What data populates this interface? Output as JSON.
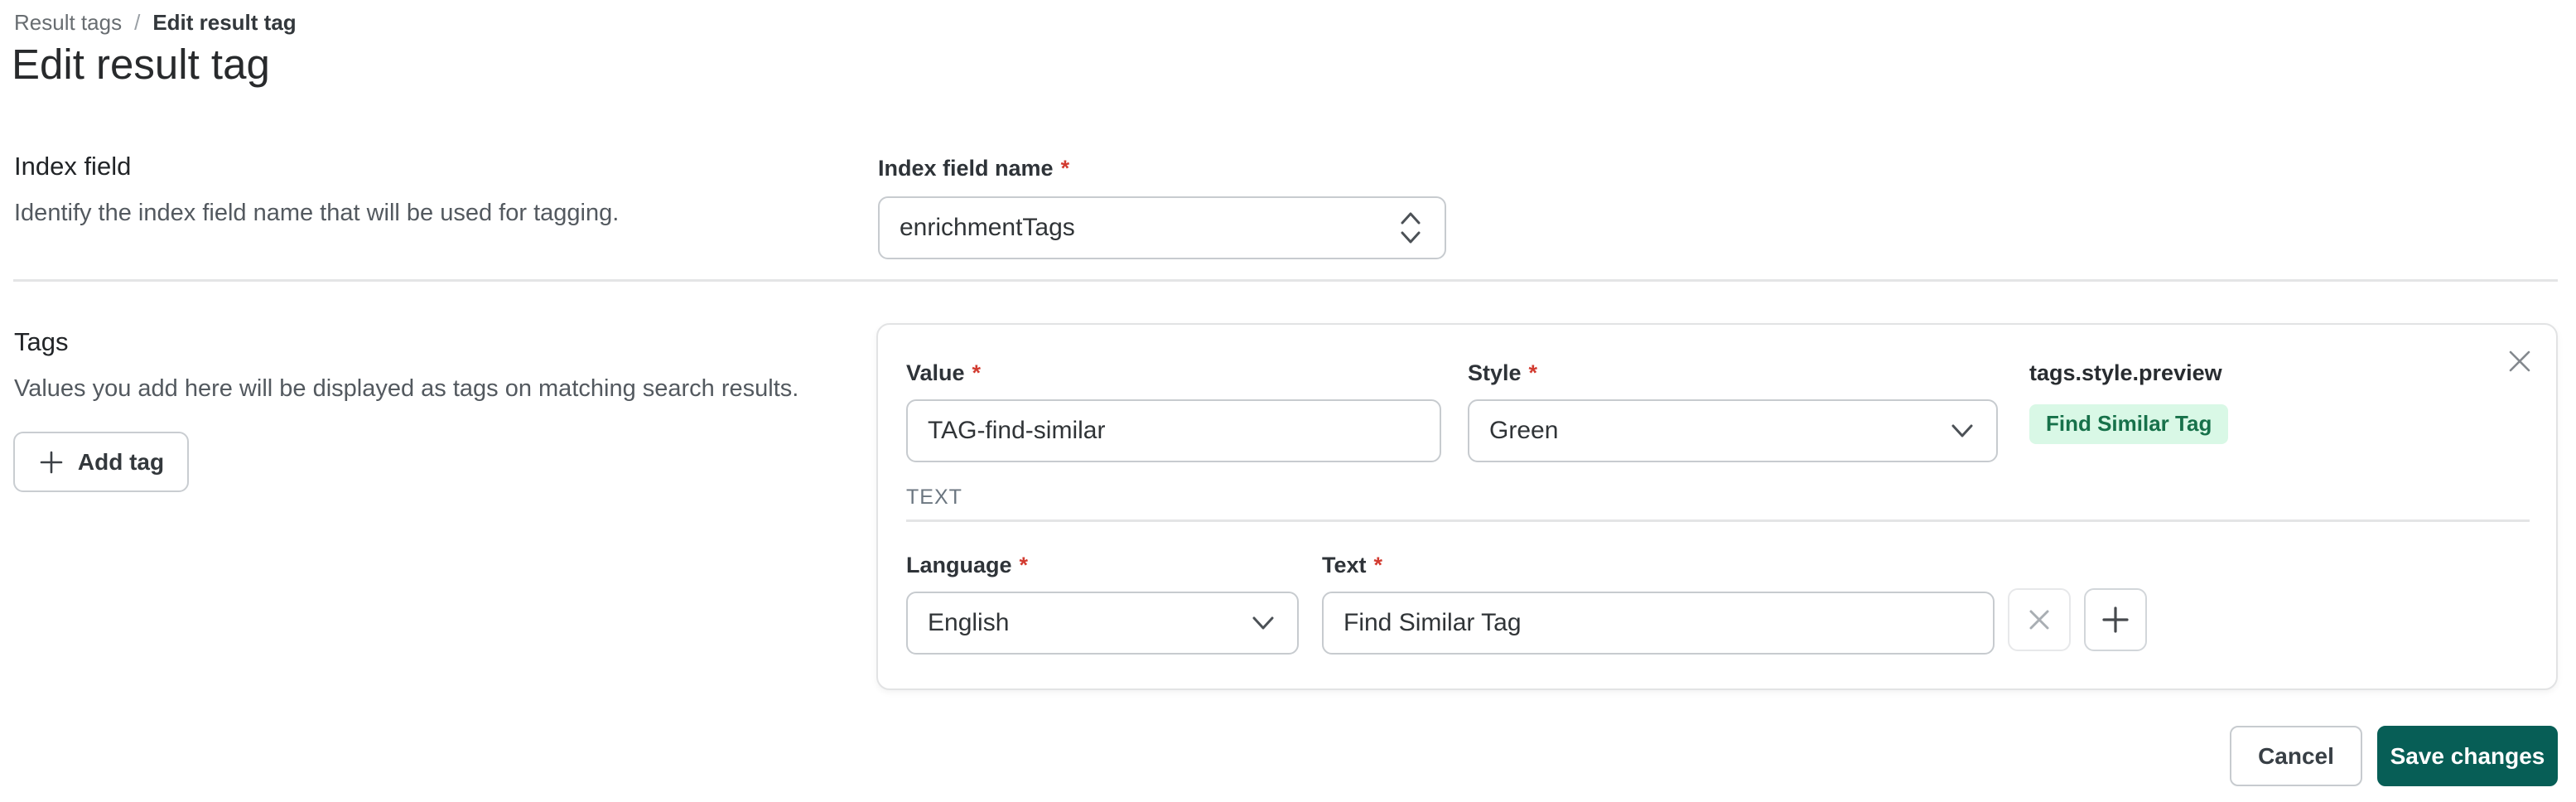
{
  "colors": {
    "accent_teal": "#075e56",
    "tag_background": "#d9f8e6",
    "tag_text": "#17714a",
    "required_red": "#d23b30"
  },
  "breadcrumb": {
    "separator": "/",
    "items": [
      {
        "label": "Result tags"
      },
      {
        "label": "Edit result tag"
      }
    ]
  },
  "page": {
    "title": "Edit result tag"
  },
  "index_field_section": {
    "heading": "Index field",
    "description": "Identify the index field name that will be used for tagging.",
    "field": {
      "label": "Index field name",
      "required": "*",
      "value": "enrichmentTags"
    }
  },
  "tags_section": {
    "heading": "Tags",
    "description": "Values you add here will be displayed as tags on matching search results.",
    "add_tag_label": "Add tag",
    "card": {
      "value_field": {
        "label": "Value",
        "required": "*",
        "value": "TAG-find-similar"
      },
      "style_field": {
        "label": "Style",
        "required": "*",
        "value": "Green"
      },
      "preview": {
        "label": "tags.style.preview",
        "tag_text": "Find Similar Tag"
      },
      "text_group": {
        "heading": "TEXT",
        "language_field": {
          "label": "Language",
          "required": "*",
          "value": "English"
        },
        "text_field": {
          "label": "Text",
          "required": "*",
          "value": "Find Similar Tag"
        }
      }
    }
  },
  "footer": {
    "cancel_label": "Cancel",
    "save_label": "Save changes"
  }
}
